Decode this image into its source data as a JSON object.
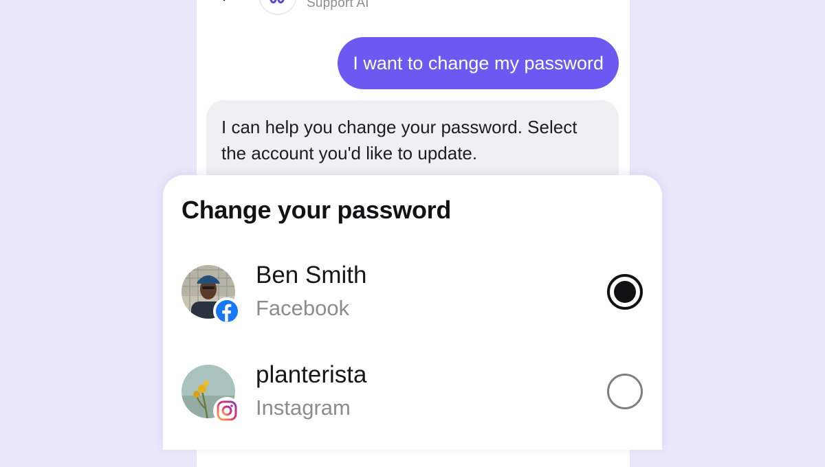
{
  "chat": {
    "assistant_subtitle": "Support AI",
    "messages": [
      {
        "role": "user",
        "text": "I want to change my password"
      },
      {
        "role": "assistant",
        "text": "I can help you change your password. Select the account you'd like to update."
      }
    ]
  },
  "sheet": {
    "title": "Change your password",
    "accounts": [
      {
        "name": "Ben Smith",
        "platform": "Facebook",
        "platform_icon": "facebook-icon",
        "selected": true
      },
      {
        "name": "planterista",
        "platform": "Instagram",
        "platform_icon": "instagram-icon",
        "selected": false
      }
    ]
  },
  "colors": {
    "background": "#ece8fb",
    "user_bubble": "#6b59f2",
    "assistant_bubble": "#f0f0f3",
    "facebook_blue": "#1877f2"
  }
}
